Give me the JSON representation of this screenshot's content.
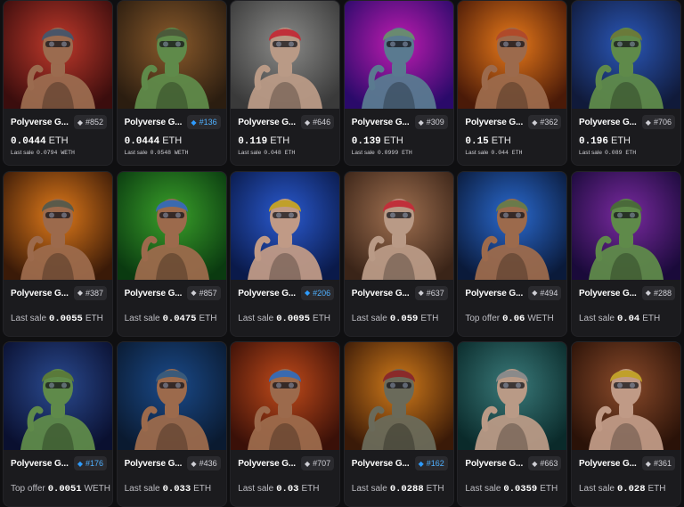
{
  "cards": [
    {
      "name": "Polyverse G...",
      "id": "#852",
      "blue": false,
      "mode": "price",
      "price": "0.0444",
      "currency": "ETH",
      "sub_label": "Last sale",
      "sub_value": "0.0794 WETH",
      "bg": [
        "#c0392b",
        "#3b0d0d"
      ],
      "skin": "#9b6b4f",
      "head": "#4a5568"
    },
    {
      "name": "Polyverse G...",
      "id": "#136",
      "blue": true,
      "mode": "price",
      "price": "0.0444",
      "currency": "ETH",
      "sub_label": "Last sale",
      "sub_value": "0.0548 WETH",
      "bg": [
        "#8a5a2b",
        "#2b1d10"
      ],
      "skin": "#5f8a4a",
      "head": "#4b5a3a"
    },
    {
      "name": "Polyverse G...",
      "id": "#646",
      "blue": false,
      "mode": "price",
      "price": "0.119",
      "currency": "ETH",
      "sub_label": "Last sale",
      "sub_value": "0.048 ETH",
      "bg": [
        "#8a8a88",
        "#3a3a3a"
      ],
      "skin": "#b99a86",
      "head": "#c0303a"
    },
    {
      "name": "Polyverse G...",
      "id": "#309",
      "blue": false,
      "mode": "price",
      "price": "0.139",
      "currency": "ETH",
      "sub_label": "Last sale",
      "sub_value": "0.0999 ETH",
      "bg": [
        "#c01cb0",
        "#2a0a6a"
      ],
      "skin": "#5a7a90",
      "head": "#6a8a70"
    },
    {
      "name": "Polyverse G...",
      "id": "#362",
      "blue": false,
      "mode": "price",
      "price": "0.15",
      "currency": "ETH",
      "sub_label": "Last sale",
      "sub_value": "0.044 ETH",
      "bg": [
        "#e8791a",
        "#4a1a08"
      ],
      "skin": "#9c6a4c",
      "head": "#b04a2a"
    },
    {
      "name": "Polyverse G...",
      "id": "#706",
      "blue": false,
      "mode": "price",
      "price": "0.196",
      "currency": "ETH",
      "sub_label": "Last sale",
      "sub_value": "0.089 ETH",
      "bg": [
        "#2a57b8",
        "#101a3a"
      ],
      "skin": "#5f8a4a",
      "head": "#6a7a3a"
    },
    {
      "name": "Polyverse G...",
      "id": "#387",
      "blue": false,
      "mode": "sale",
      "label": "Last sale",
      "value": "0.0055",
      "currency": "ETH",
      "bg": [
        "#e07a1a",
        "#3a1a08"
      ],
      "skin": "#9c6a4c",
      "head": "#5a5a4a"
    },
    {
      "name": "Polyverse G...",
      "id": "#857",
      "blue": false,
      "mode": "sale",
      "label": "Last sale",
      "value": "0.0475",
      "currency": "ETH",
      "bg": [
        "#3aa02a",
        "#0a3a10"
      ],
      "skin": "#9c6a4c",
      "head": "#3a6ab0"
    },
    {
      "name": "Polyverse G...",
      "id": "#206",
      "blue": true,
      "mode": "sale",
      "label": "Last sale",
      "value": "0.0095",
      "currency": "ETH",
      "bg": [
        "#2a5ad0",
        "#0a1a4a"
      ],
      "skin": "#c09a86",
      "head": "#c0a02a"
    },
    {
      "name": "Polyverse G...",
      "id": "#637",
      "blue": false,
      "mode": "sale",
      "label": "Last sale",
      "value": "0.059",
      "currency": "ETH",
      "bg": [
        "#a07050",
        "#3a2418"
      ],
      "skin": "#b99a86",
      "head": "#c0303a"
    },
    {
      "name": "Polyverse G...",
      "id": "#494",
      "blue": false,
      "mode": "sale",
      "label": "Top offer",
      "value": "0.06",
      "currency": "WETH",
      "bg": [
        "#2a6ad0",
        "#0a1a3a"
      ],
      "skin": "#9c6a4c",
      "head": "#6a7a4a"
    },
    {
      "name": "Polyverse G...",
      "id": "#288",
      "blue": false,
      "mode": "sale",
      "label": "Last sale",
      "value": "0.04",
      "currency": "ETH",
      "bg": [
        "#7a2aa0",
        "#1a0a3a"
      ],
      "skin": "#5f8a4a",
      "head": "#4a6a3a"
    },
    {
      "name": "Polyverse G...",
      "id": "#176",
      "blue": true,
      "mode": "sale",
      "label": "Top offer",
      "value": "0.0051",
      "currency": "WETH",
      "bg": [
        "#2a4a90",
        "#0a1030"
      ],
      "skin": "#5f8a4a",
      "head": "#5a7a3a"
    },
    {
      "name": "Polyverse G...",
      "id": "#436",
      "blue": false,
      "mode": "sale",
      "label": "Last sale",
      "value": "0.033",
      "currency": "ETH",
      "bg": [
        "#1a4a8a",
        "#0a1a30"
      ],
      "skin": "#9c6a4c",
      "head": "#3a5a7a"
    },
    {
      "name": "Polyverse G...",
      "id": "#707",
      "blue": false,
      "mode": "sale",
      "label": "Last sale",
      "value": "0.03",
      "currency": "ETH",
      "bg": [
        "#c04a1a",
        "#3a1008"
      ],
      "skin": "#9c6a4c",
      "head": "#3a6ab0"
    },
    {
      "name": "Polyverse G...",
      "id": "#162",
      "blue": true,
      "mode": "sale",
      "label": "Last sale",
      "value": "0.0288",
      "currency": "ETH",
      "bg": [
        "#d07a1a",
        "#3a1a08"
      ],
      "skin": "#6a6a5a",
      "head": "#8a2a2a"
    },
    {
      "name": "Polyverse G...",
      "id": "#663",
      "blue": false,
      "mode": "sale",
      "label": "Last sale",
      "value": "0.0359",
      "currency": "ETH",
      "bg": [
        "#3a7a7a",
        "#0a2a2a"
      ],
      "skin": "#b99a86",
      "head": "#8a8a8a"
    },
    {
      "name": "Polyverse G...",
      "id": "#361",
      "blue": false,
      "mode": "sale",
      "label": "Last sale",
      "value": "0.028",
      "currency": "ETH",
      "bg": [
        "#8a4a2a",
        "#2a1208"
      ],
      "skin": "#c09a86",
      "head": "#c0a02a"
    }
  ]
}
